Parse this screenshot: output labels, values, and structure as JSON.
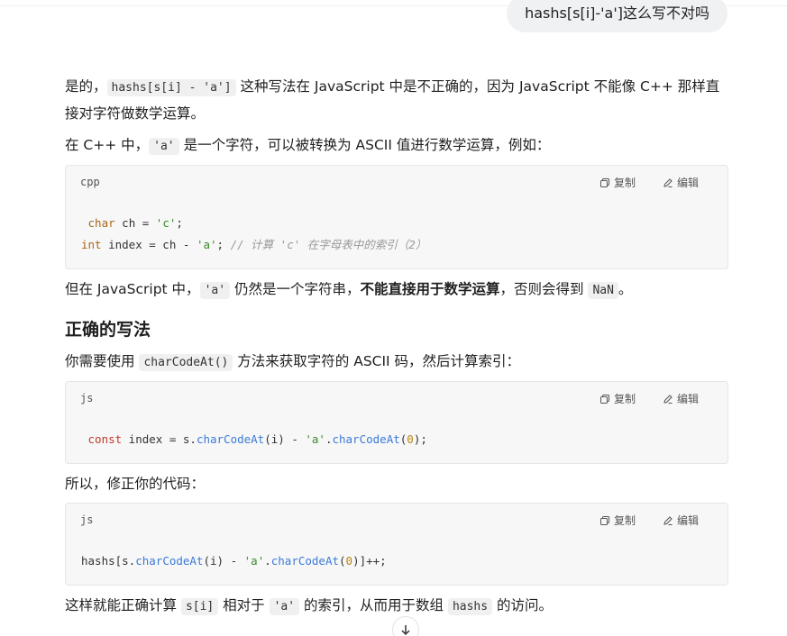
{
  "user_message": "hashs[s[i]-'a']这么写不对吗",
  "p1": {
    "before": "是的，",
    "code": "hashs[s[i] - 'a']",
    "after": " 这种写法在 JavaScript 中是不正确的，因为 JavaScript 不能像 C++ 那样直接对字符做数学运算。"
  },
  "p2": {
    "before": "在 C++ 中，",
    "code": "'a'",
    "after": " 是一个字符，可以被转换为 ASCII 值进行数学运算，例如："
  },
  "code_actions": {
    "copy": "复制",
    "edit": "编辑"
  },
  "code1": {
    "lang": "cpp",
    "line1": {
      "t1": " char",
      "t2": " ch = ",
      "t3": "'c'",
      "t4": ";"
    },
    "line2": {
      "t1": "int",
      "t2": " index = ch - ",
      "t3": "'a'",
      "t4": "; ",
      "t5": "// 计算 'c' 在字母表中的索引（2）"
    }
  },
  "p3": {
    "before": "但在 JavaScript 中，",
    "code": "'a'",
    "middle": " 仍然是一个字符串，",
    "bold": "不能直接用于数学运算",
    "after": "，否则会得到 ",
    "code2": "NaN",
    "end": "。"
  },
  "heading": "正确的写法",
  "p4": {
    "before": "你需要使用 ",
    "code": "charCodeAt()",
    "after": " 方法来获取字符的 ASCII 码，然后计算索引："
  },
  "code2": {
    "lang": "js",
    "t1": " const",
    "t2": " index = s.",
    "t3": "charCodeAt",
    "t4": "(i) - ",
    "t5": "'a'",
    "t6": ".",
    "t7": "charCodeAt",
    "t8": "(",
    "t9": "0",
    "t10": ");"
  },
  "p5": "所以，修正你的代码：",
  "code3": {
    "lang": "js",
    "t1": "hashs[s.",
    "t2": "charCodeAt",
    "t3": "(i) - ",
    "t4": "'a'",
    "t5": ".",
    "t6": "charCodeAt",
    "t7": "(",
    "t8": "0",
    "t9": ")]++;"
  },
  "p6": {
    "before": "这样就能正确计算 ",
    "code": "s[i]",
    "middle": " 相对于 ",
    "code2": "'a'",
    "after": " 的索引，从而用于数组 ",
    "code3": "hashs",
    "end": " 的访问。"
  },
  "icons": {
    "copy": "copy-icon",
    "edit": "edit-icon",
    "scroll": "arrow-down-icon"
  }
}
